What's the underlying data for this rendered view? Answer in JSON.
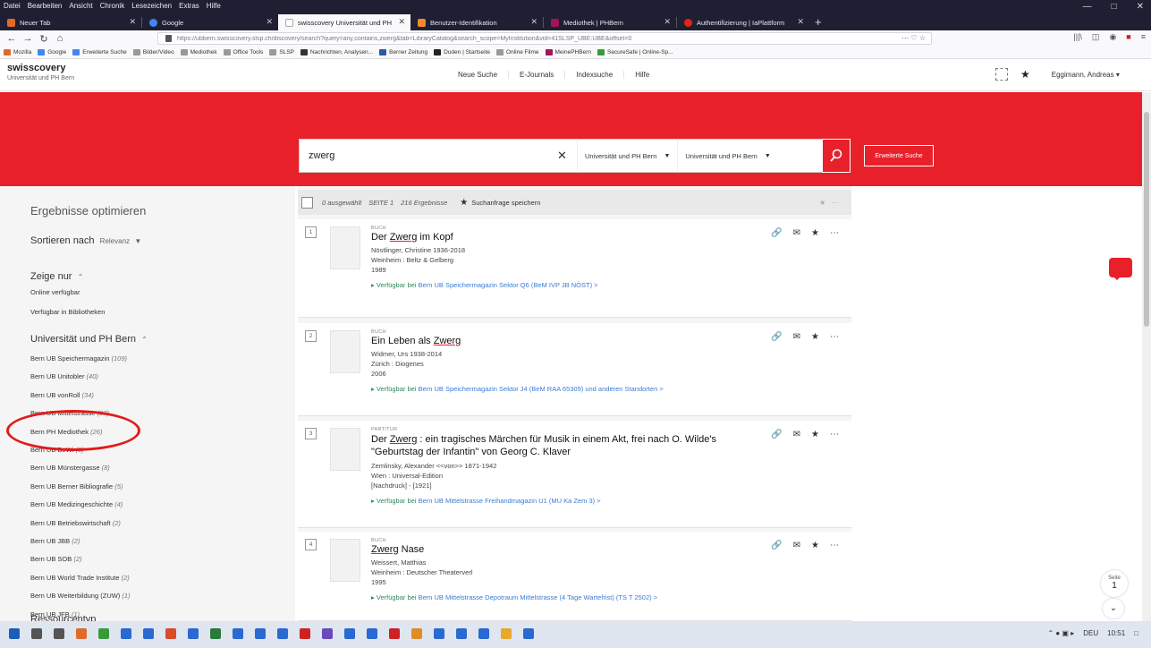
{
  "browser": {
    "menu": [
      "Datei",
      "Bearbeiten",
      "Ansicht",
      "Chronik",
      "Lesezeichen",
      "Extras",
      "Hilfe"
    ],
    "tabs": [
      {
        "label": "Neuer Tab",
        "color": "#e06a2a",
        "active": false
      },
      {
        "label": "Google",
        "color": "#4285f4",
        "active": false
      },
      {
        "label": "swisscovery Universität und PH",
        "color": "#ffffff",
        "active": true
      },
      {
        "label": "Benutzer-Identifikation",
        "color": "#f08a2a",
        "active": false
      },
      {
        "label": "Mediothek | PHBern",
        "color": "#a3145a",
        "active": false
      },
      {
        "label": "Authentifizierung | IaPlattform",
        "color": "#e2231a",
        "active": false
      }
    ],
    "url": "https://ubbern.swisscovery.slsp.ch/discovery/search?query=any,contains,zwerg&tab=LibraryCatalog&search_scope=MyInstitution&vid=41SLSP_UBE:UBE&offset=0",
    "bookmarks": [
      {
        "label": "Mozilla",
        "color": "#e06a2a"
      },
      {
        "label": "Google",
        "color": "#4285f4"
      },
      {
        "label": "Erweiterte Suche",
        "color": "#4285f4"
      },
      {
        "label": "Bilder/Video",
        "color": "#999999"
      },
      {
        "label": "Mediothek",
        "color": "#999999"
      },
      {
        "label": "Office Tools",
        "color": "#999999"
      },
      {
        "label": "SLSP",
        "color": "#999999"
      },
      {
        "label": "Nachrichten, Analysen...",
        "color": "#333333"
      },
      {
        "label": "Berner Zeitung",
        "color": "#2a5aa8"
      },
      {
        "label": "Duden | Startseite",
        "color": "#222222"
      },
      {
        "label": "Online Filme",
        "color": "#999999"
      },
      {
        "label": "MeinePHBern",
        "color": "#a3145a"
      },
      {
        "label": "SecureSafe | Online-Sp...",
        "color": "#3a9a3a"
      }
    ]
  },
  "app": {
    "brand": "swisscovery",
    "institution": "Universität und PH Bern",
    "nav": [
      "Neue Suche",
      "E-Journals",
      "Indexsuche",
      "Hilfe"
    ],
    "user": "Eggimann, Andreas"
  },
  "search": {
    "query": "zwerg",
    "scope1": "Universität und PH Bern",
    "scope2": "Universität und PH Bern",
    "advanced_label": "Erweiterte Suche"
  },
  "facets": {
    "heading": "Ergebnisse optimieren",
    "sort_label": "Sortieren nach",
    "sort_value": "Relevanz",
    "show_only_label": "Zeige nur",
    "show_only_items": [
      "Online verfügbar",
      "Verfügbar in Bibliotheken"
    ],
    "library_heading": "Universität und PH Bern",
    "libraries": [
      {
        "name": "Bern UB Speichermagazin",
        "count": "(109)"
      },
      {
        "name": "Bern UB Unitobler",
        "count": "(40)"
      },
      {
        "name": "Bern UB vonRoll",
        "count": "(34)"
      },
      {
        "name": "Bern UB Mittelstrasse",
        "count": "(27)"
      },
      {
        "name": "Bern PH Mediothek",
        "count": "(26)"
      },
      {
        "name": "Bern UB BeWi",
        "count": "(8)"
      },
      {
        "name": "Bern UB Münstergasse",
        "count": "(8)"
      },
      {
        "name": "Bern UB Berner Bibliografie",
        "count": "(5)"
      },
      {
        "name": "Bern UB Medizingeschichte",
        "count": "(4)"
      },
      {
        "name": "Bern UB Betriebswirtschaft",
        "count": "(2)"
      },
      {
        "name": "Bern UB JBB",
        "count": "(2)"
      },
      {
        "name": "Bern UB SOB",
        "count": "(2)"
      },
      {
        "name": "Bern UB World Trade Institute",
        "count": "(2)"
      },
      {
        "name": "Bern UB Weiterbildung (ZUW)",
        "count": "(1)"
      },
      {
        "name": "Bern UB JFB",
        "count": "(1)"
      }
    ],
    "next_heading": "Ressourcentyp"
  },
  "results": {
    "selected": "0 ausgewählt",
    "page": "SEITE 1",
    "count": "216 Ergebnisse",
    "save_query": "Suchanfrage speichern",
    "items": [
      {
        "num": "1",
        "type": "BUCH",
        "title_pre": "Der ",
        "title_hl": "Zwerg",
        "title_post": " im Kopf",
        "author": "Nöstlinger, Christine 1936-2018",
        "publisher": "Weinheim : Beltz & Gelberg",
        "extra": "",
        "year": "1989",
        "avail": "Verfügbar bei",
        "location": "Bern UB Speichermagazin  Sektor Q6 (BeM IVP JB NÖST)  >"
      },
      {
        "num": "2",
        "type": "BUCH",
        "title_pre": "Ein Leben als ",
        "title_hl": "Zwerg",
        "title_post": "",
        "author": "Widmer, Urs 1938-2014",
        "publisher": "Zürich : Diogenes",
        "extra": "",
        "year": "2006",
        "avail": "Verfügbar bei",
        "location": "Bern UB Speichermagazin  Sektor J4 (BeM RAA 65309) und anderen Standorten  >"
      },
      {
        "num": "3",
        "type": "PARTITUR",
        "title_pre": "Der ",
        "title_hl": "Zwerg",
        "title_post": " : ein tragisches Märchen für Musik in einem Akt, frei nach O. Wilde's \"Geburtstag der Infantin\" von Georg C. Klaver",
        "author": "Zemlinsky, Alexander <<von>> 1871-1942",
        "publisher": "Wien : Universal-Edition",
        "extra": "[Nachdruck] - [1921]",
        "year": "",
        "avail": "Verfügbar bei",
        "location": "Bern UB Mittelstrasse  Freihandmagazin U1 (MU Ka Zem 3)  >"
      },
      {
        "num": "4",
        "type": "BUCH",
        "title_pre": "",
        "title_hl": "Zwerg",
        "title_post": " Nase",
        "author": "Weissert, Matthias",
        "publisher": "Weinheim : Deutscher Theaterverl",
        "extra": "",
        "year": "1995",
        "avail": "Verfügbar bei",
        "location": "Bern UB Mittelstrasse  Depotraum Mittelstrasse (4 Tage Wartefrist) (TS T 2502)  >"
      }
    ]
  },
  "pager": {
    "label": "Seite",
    "number": "1"
  },
  "taskbar": {
    "lang": "DEU",
    "time": "10:51"
  },
  "colors": {
    "brand_red": "#e8202a",
    "available_green": "#2e8b57",
    "link_blue": "#3a7bd5"
  }
}
